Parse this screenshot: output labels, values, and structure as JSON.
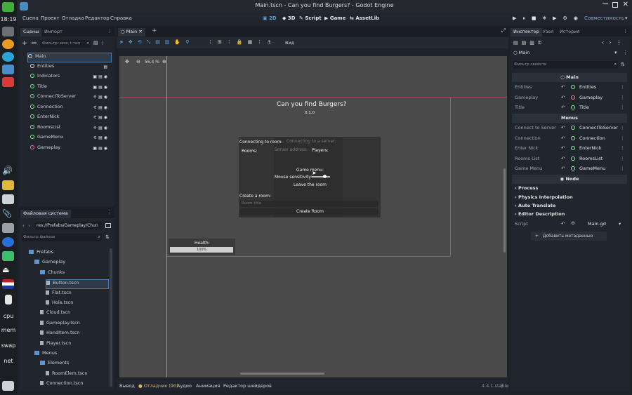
{
  "taskbar": {
    "time": "18:19",
    "cpu": "cpu",
    "mem": "mem",
    "swap": "swap",
    "net": "net"
  },
  "window": {
    "title": "Main.tscn - Can you find Burgers? - Godot Engine"
  },
  "menubar": {
    "items": [
      "Сцена",
      "Проект",
      "Отладка",
      "Редактор",
      "Справка"
    ],
    "modes": [
      "2D",
      "3D",
      "Script",
      "Game",
      "AssetLib"
    ],
    "renderer": "Совместимость"
  },
  "scene_dock": {
    "tabs": [
      "Сцены",
      "Импорт"
    ],
    "filter_placeholder": "Фильтр: имя, t:тип",
    "nodes": [
      {
        "name": "Main",
        "icon_color": "#e2e5e9"
      },
      {
        "name": "Entities",
        "icon_color": "#e2e5e9"
      },
      {
        "name": "Indicators",
        "icon_color": "#8eef97"
      },
      {
        "name": "Title",
        "icon_color": "#8eef97"
      },
      {
        "name": "ConnectToServer",
        "icon_color": "#8eef97"
      },
      {
        "name": "Connection",
        "icon_color": "#8eef97"
      },
      {
        "name": "EnterNick",
        "icon_color": "#8eef97"
      },
      {
        "name": "RoomsList",
        "icon_color": "#8eef97"
      },
      {
        "name": "GameMenu",
        "icon_color": "#8eef97"
      },
      {
        "name": "Gameplay",
        "icon_color": "#fc7f7f"
      }
    ]
  },
  "filesystem_dock": {
    "tab": "Файловая система",
    "path": "res://Prefabs/Gameplay/Chun",
    "filter_placeholder": "Фильтр файлов",
    "files": [
      {
        "name": "Prefabs",
        "depth": 1,
        "folder": true
      },
      {
        "name": "Gameplay",
        "depth": 2,
        "folder": true
      },
      {
        "name": "Chunks",
        "depth": 3,
        "folder": true
      },
      {
        "name": "Button.tscn",
        "depth": 4,
        "folder": false
      },
      {
        "name": "Flat.tscn",
        "depth": 4,
        "folder": false
      },
      {
        "name": "Hole.tscn",
        "depth": 4,
        "folder": false
      },
      {
        "name": "Cloud.tscn",
        "depth": 3,
        "folder": false
      },
      {
        "name": "Gameplay.tscn",
        "depth": 3,
        "folder": false
      },
      {
        "name": "HandItem.tscn",
        "depth": 3,
        "folder": false
      },
      {
        "name": "Player.tscn",
        "depth": 3,
        "folder": false
      },
      {
        "name": "Menus",
        "depth": 2,
        "folder": true
      },
      {
        "name": "Elements",
        "depth": 3,
        "folder": true
      },
      {
        "name": "RoomElem.tscn",
        "depth": 4,
        "folder": false
      },
      {
        "name": "Connection.tscn",
        "depth": 3,
        "folder": false
      }
    ]
  },
  "editor": {
    "tab": "Main",
    "view_label": "Вид",
    "zoom": "56.4 %"
  },
  "game": {
    "title": "Can you find Burgers?",
    "version": "0.1.0",
    "connecting_label": "Connecting to room:",
    "connecting_ghost": "Connecting to a server:",
    "server_address_ghost": "Server address:",
    "rooms_label": "Rooms:",
    "players_label": "Players:",
    "game_menu_label": "Game menu:",
    "mouse_sensitivity": "Mouse sensitivity:",
    "leave_room": "Leave the room",
    "create_room_label": "Create a room:",
    "room_title_placeholder": "Room title",
    "create_room_button": "Create Room",
    "health_label": "Health:",
    "health_value": "100%",
    "mouse_sensitivity_level": 0.6
  },
  "bottom_panel": {
    "tabs": [
      "Вывод",
      "Отладчик (90)",
      "Аудио",
      "Анимация",
      "Редактор шейдеров"
    ],
    "version": "4.4.1.stable"
  },
  "inspector": {
    "tabs": [
      "Инспектор",
      "Узел",
      "История"
    ],
    "node_name": "Main",
    "filter_placeholder": "Фильтр свойств",
    "section_main": "Main",
    "main_props": [
      {
        "label": "Entities",
        "value": "Entities"
      },
      {
        "label": "Gameplay",
        "value": "Gameplay"
      },
      {
        "label": "Title",
        "value": "Title"
      }
    ],
    "section_menus": "Menus",
    "menu_props": [
      {
        "label": "Connect to Server",
        "value": "ConnectToServer"
      },
      {
        "label": "Connection",
        "value": "Connection"
      },
      {
        "label": "Enter Nick",
        "value": "EnterNick"
      },
      {
        "label": "Rooms List",
        "value": "RoomsList"
      },
      {
        "label": "Game Menu",
        "value": "GameMenu"
      }
    ],
    "section_node": "Node",
    "groups": [
      "Process",
      "Physics Interpolation",
      "Auto Translate",
      "Editor Description"
    ],
    "script_label": "Script",
    "script_value": "Main.gd",
    "add_metadata": "Добавить метаданные"
  },
  "colors": {
    "accent": "#478cbf",
    "viewport_bg": "#4a4a4a",
    "green_icon": "#8eef97"
  }
}
